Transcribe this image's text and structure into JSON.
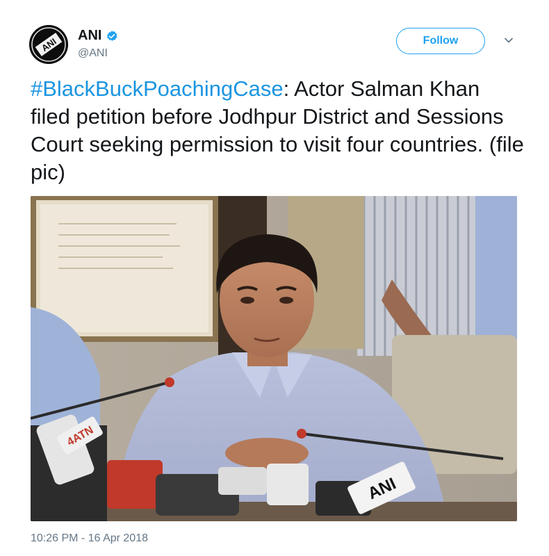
{
  "tweet": {
    "author": {
      "name": "ANI",
      "handle": "@ANI",
      "verified": true,
      "avatar_text": "ANI"
    },
    "follow_label": "Follow",
    "text": {
      "hashtag": "#BlackBuckPoachingCase",
      "body": ": Actor Salman Khan filed petition before Jodhpur District and Sessions Court seeking permission to visit four countries. (file pic)"
    },
    "media": {
      "mic_label_ani": "ANI",
      "mic_label_other": "4ATN"
    },
    "timestamp": "10:26 PM - 16 Apr 2018"
  },
  "colors": {
    "accent": "#1da1f2",
    "hashtag": "#1b95e0",
    "muted": "#657786",
    "text": "#14171a"
  },
  "icons": {
    "verified": "verified-badge-icon",
    "caret": "chevron-down-icon"
  }
}
